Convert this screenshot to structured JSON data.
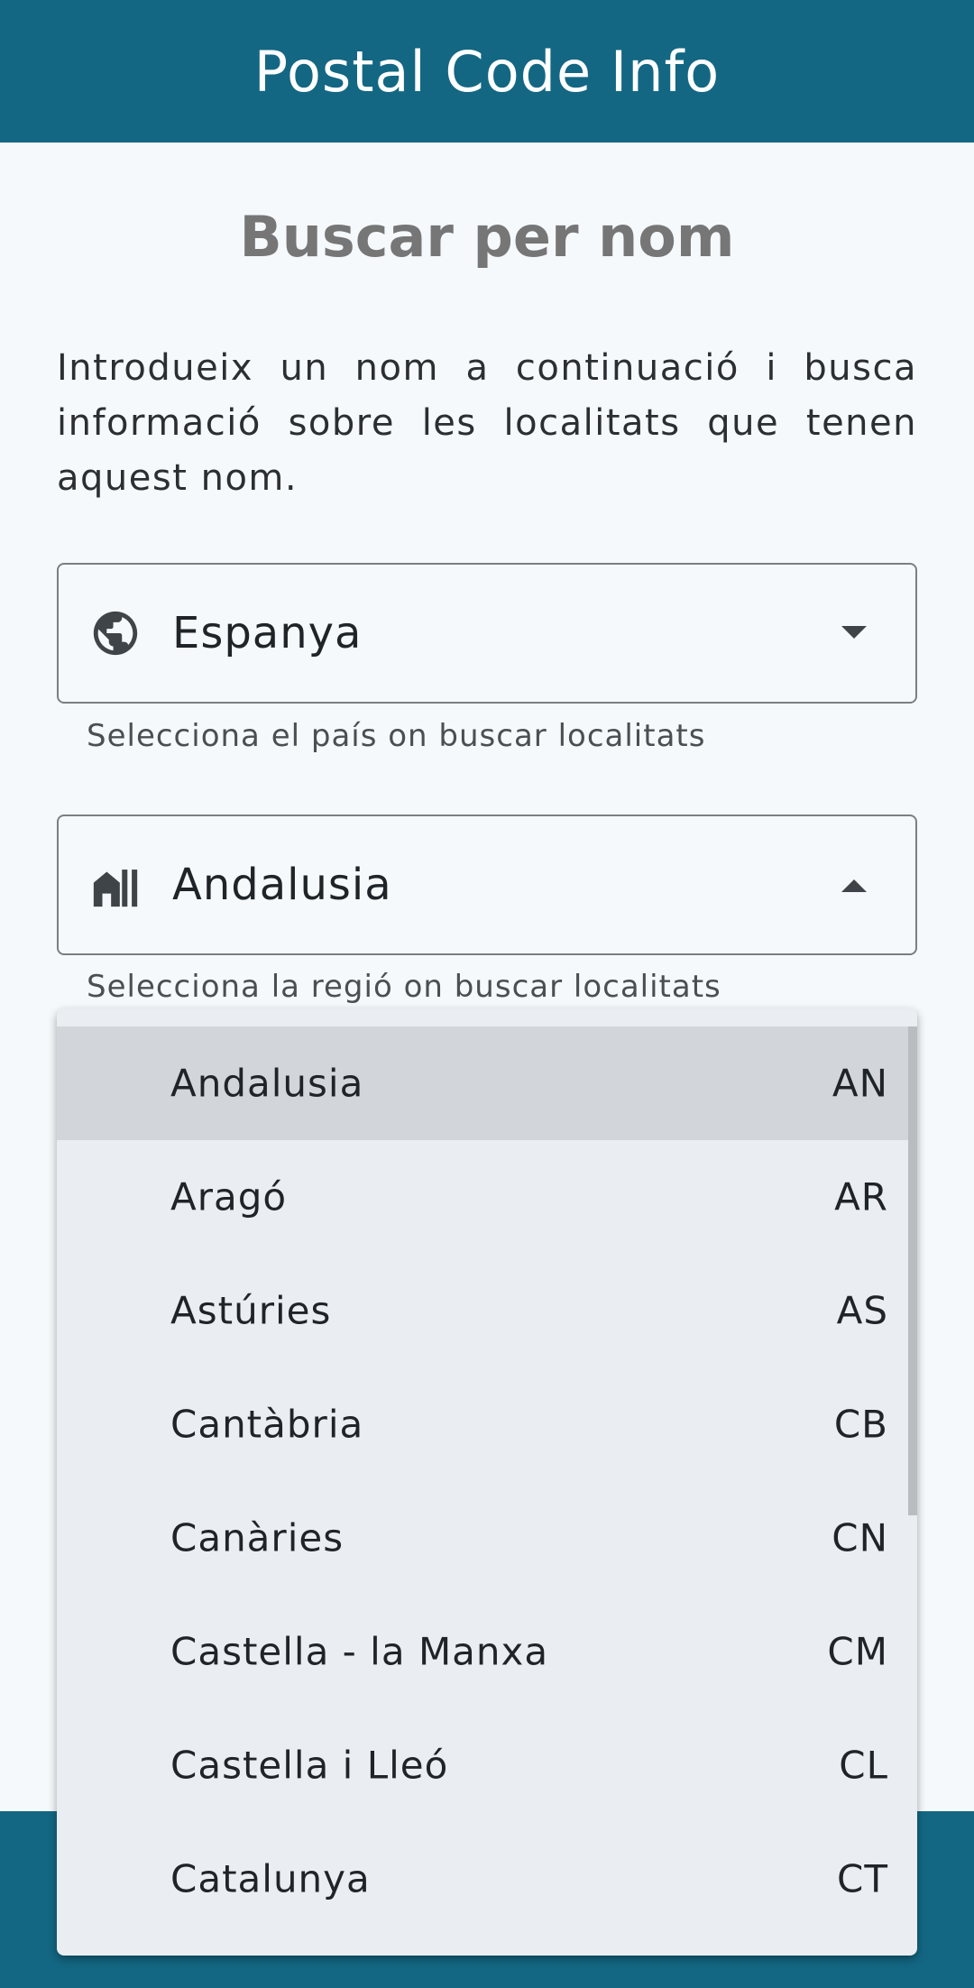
{
  "app_bar": {
    "title": "Postal Code Info"
  },
  "page": {
    "title": "Buscar per nom",
    "intro": "Introdueix un nom a continuació i busca informació sobre les localitats que tenen aquest nom."
  },
  "country_field": {
    "value": "Espanya",
    "helper": "Selecciona el país on buscar localitats",
    "icon": "globe-icon"
  },
  "region_field": {
    "value": "Andalusia",
    "helper": "Selecciona la regió on buscar localitats",
    "icon": "buildings-icon"
  },
  "region_dropdown": {
    "selected_index": 0,
    "items": [
      {
        "name": "Andalusia",
        "code": "AN"
      },
      {
        "name": "Aragó",
        "code": "AR"
      },
      {
        "name": "Astúries",
        "code": "AS"
      },
      {
        "name": "Cantàbria",
        "code": "CB"
      },
      {
        "name": "Canàries",
        "code": "CN"
      },
      {
        "name": "Castella - la Manxa",
        "code": "CM"
      },
      {
        "name": "Castella i Lleó",
        "code": "CL"
      },
      {
        "name": "Catalunya",
        "code": "CT"
      }
    ]
  },
  "colors": {
    "primary": "#136783",
    "background": "#f5f9fc",
    "menu": "#eaedf1",
    "menu_selected": "#d2d5da"
  }
}
